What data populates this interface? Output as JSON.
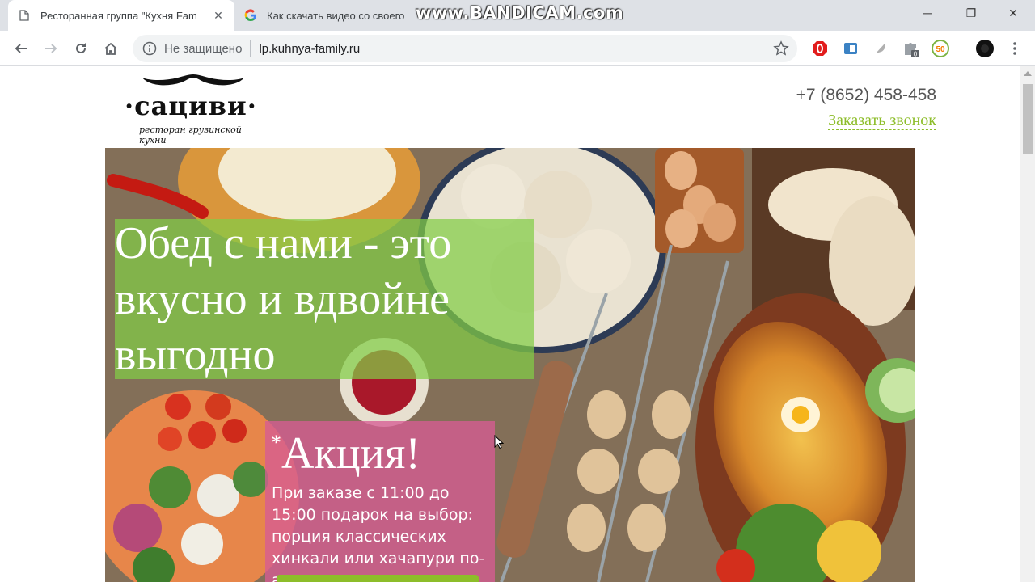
{
  "browser": {
    "tabs": [
      {
        "title": "Ресторанная группа \"Кухня Fam",
        "icon": "page-icon",
        "active": true
      },
      {
        "title": "Как скачать видео со своего",
        "icon": "google-icon",
        "active": false
      }
    ],
    "window_controls": {
      "minimize": "─",
      "restore": "❐",
      "close": "✕"
    },
    "watermark": "www.BANDICAM.com",
    "address_bar": {
      "security_text": "Не защищено",
      "url": "lp.kuhnya-family.ru"
    },
    "extensions": [
      "opera-vpn-icon",
      "extension-blue-icon",
      "feather-icon",
      "puzzle-icon",
      "coupon-50-icon",
      "profile-avatar-icon"
    ],
    "extension_badge": "0",
    "coupon_label": "50"
  },
  "site": {
    "logo": {
      "brand": "·сациви·",
      "tagline": "ресторан грузинской кухни"
    },
    "phone": "+7 (8652) 458-458",
    "callback_link": "Заказать звонок",
    "hero": {
      "headline": "Обед с нами - это вкусно и вдвойне выгодно",
      "promo_mark": "*",
      "promo_title": "Акция!",
      "promo_text": "При заказе с 11:00 до 15:00 подарок на выбор: порция классических хинкали или хачапури по-аджарски"
    }
  },
  "colors": {
    "accent_green": "#8dbd2a",
    "promo_pink": "#d65c94",
    "tab_strip": "#dee1e6"
  }
}
